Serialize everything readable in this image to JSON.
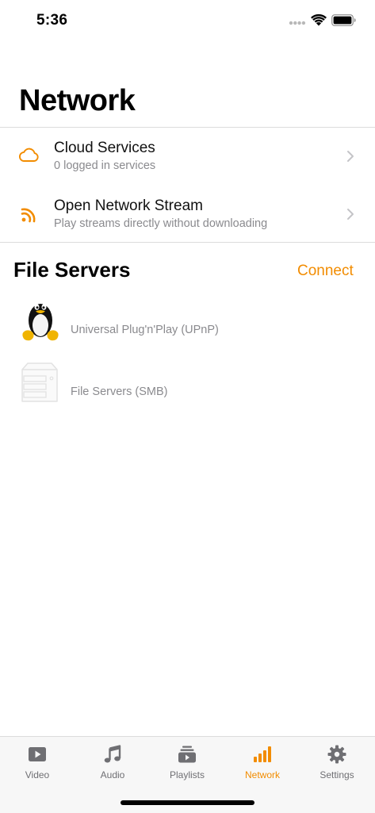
{
  "status_bar": {
    "time": "5:36"
  },
  "header": {
    "title": "Network"
  },
  "rows": [
    {
      "title": "Cloud Services",
      "subtitle": "0 logged in services",
      "icon": "cloud-icon"
    },
    {
      "title": "Open Network Stream",
      "subtitle": "Play streams directly without downloading",
      "icon": "rss-icon"
    }
  ],
  "file_servers": {
    "title": "File Servers",
    "connect_label": "Connect",
    "items": [
      {
        "label": "Universal Plug'n'Play (UPnP)",
        "icon": "linux-penguin-icon"
      },
      {
        "label": "File Servers (SMB)",
        "icon": "server-icon"
      }
    ]
  },
  "tabbar": {
    "tabs": [
      {
        "label": "Video",
        "icon": "video-icon"
      },
      {
        "label": "Audio",
        "icon": "music-note-icon"
      },
      {
        "label": "Playlists",
        "icon": "playlists-icon"
      },
      {
        "label": "Network",
        "icon": "network-bars-icon",
        "active": true
      },
      {
        "label": "Settings",
        "icon": "gear-icon"
      }
    ]
  },
  "colors": {
    "accent": "#f28c00",
    "secondary_text": "#8a8a8e",
    "tab_inactive": "#6f6f73"
  }
}
